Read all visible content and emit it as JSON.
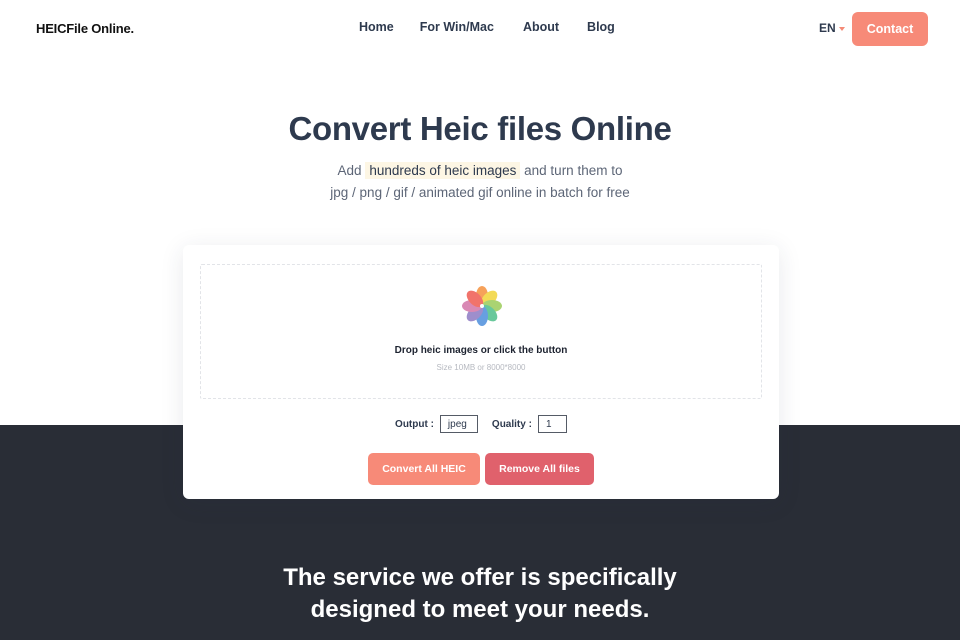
{
  "header": {
    "logo_bold": "HEICFile",
    "logo_regular": " Online.",
    "nav": [
      {
        "label": "Home"
      },
      {
        "label": "For Win/Mac"
      },
      {
        "label": "About"
      },
      {
        "label": "Blog"
      }
    ],
    "language": "EN",
    "contact_label": "Contact"
  },
  "hero": {
    "title": "Convert Heic files Online",
    "subtitle_prefix": "Add ",
    "subtitle_highlight": "hundreds of heic images",
    "subtitle_suffix": " and turn them to",
    "subtitle_line2": "jpg / png / gif / animated gif online in batch for free"
  },
  "uploader": {
    "drop_text": "Drop heic images or click the button",
    "drop_hint": "Size 10MB or 8000*8000",
    "output_label": "Output :",
    "output_value": "jpeg",
    "quality_label": "Quality :",
    "quality_value": "1",
    "convert_label": "Convert All HEIC",
    "remove_label": "Remove All files"
  },
  "service": {
    "line1": "The service we offer is specifically",
    "line2": "designed to meet your needs."
  },
  "colors": {
    "accent": "#f78a78",
    "remove": "#e0616c",
    "dark_bg": "#292d36",
    "text": "#2e3a4e",
    "highlight_bg": "#fdf6e4"
  }
}
